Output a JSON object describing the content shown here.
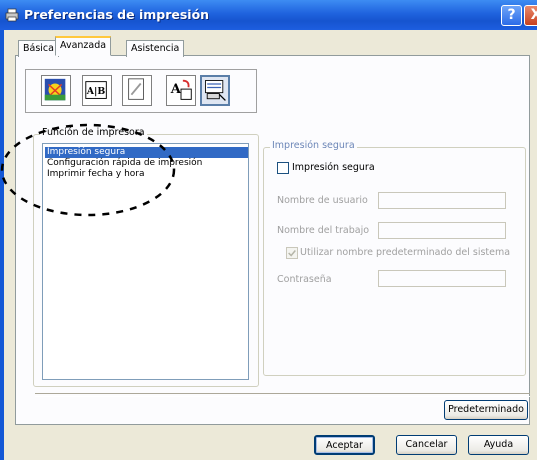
{
  "window": {
    "title": "Preferencias de impresión",
    "help_label": "?",
    "close_label": "X"
  },
  "tabs": [
    {
      "label": "Básica",
      "active": false
    },
    {
      "label": "Avanzada",
      "active": true
    },
    {
      "label": "Asistencia",
      "active": false
    }
  ],
  "toolbar": {
    "tools": [
      "calidad-icon",
      "duplex-icon",
      "marca-agua-icon",
      "escala-icon",
      "funcion-impresora-icon"
    ],
    "selected_index": 4,
    "duplex_text": "A|B",
    "escala_text": "A"
  },
  "printer_function": {
    "label": "Función de impresora",
    "items": [
      "Impresión segura",
      "Configuración rápida de impresión",
      "Imprimir fecha y hora"
    ],
    "selected_index": 0
  },
  "secure_print": {
    "group_label": "Impresión segura",
    "checkbox_label": "Impresión segura",
    "checked": false,
    "user_name_label": "Nombre de usuario",
    "job_name_label": "Nombre del trabajo",
    "default_name_label": "Utilizar nombre predeterminado del sistema",
    "default_name_checked": true,
    "password_label": "Contraseña"
  },
  "buttons": {
    "default": "Predeterminado",
    "accept": "Aceptar",
    "cancel": "Cancelar",
    "help": "Ayuda"
  },
  "colors": {
    "titlebar": "#1f63de",
    "selection": "#316ac5",
    "active_tab_accent": "#ffc83c"
  }
}
